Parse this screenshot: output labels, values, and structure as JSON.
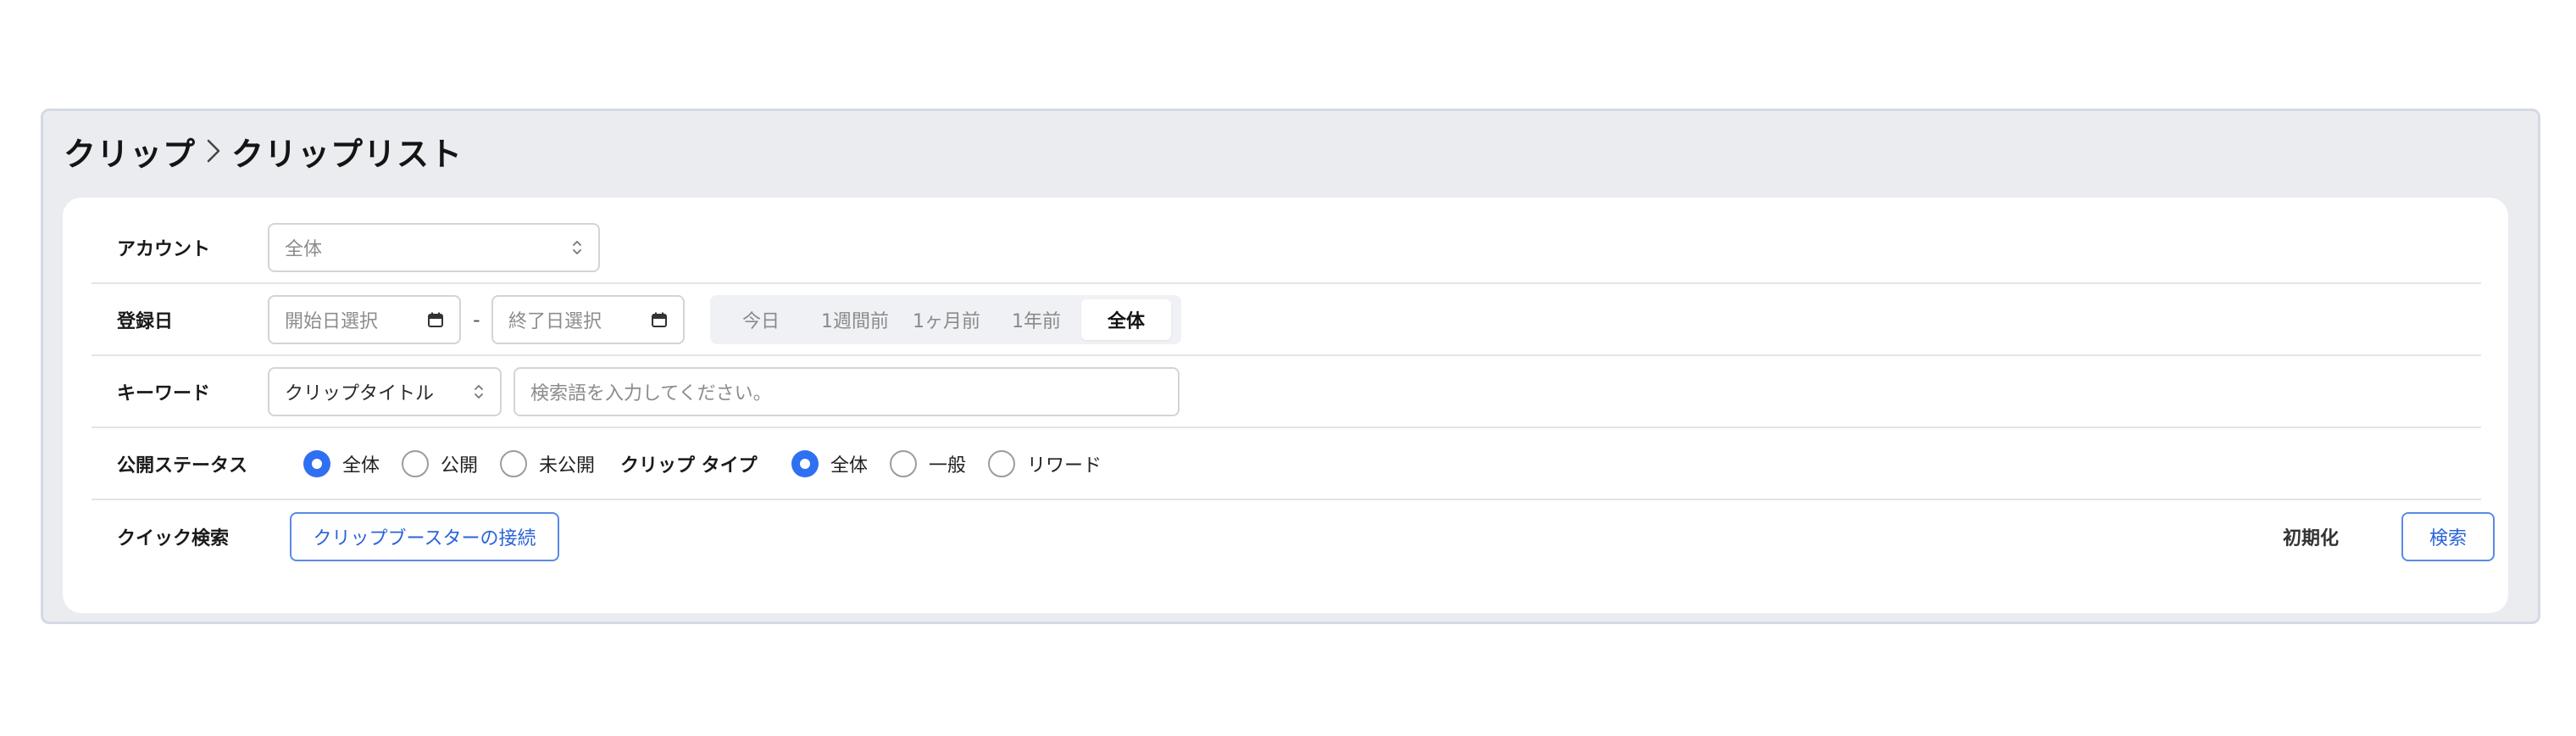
{
  "breadcrumb": {
    "parent": "クリップ",
    "current": "クリップリスト"
  },
  "filters": {
    "account": {
      "label": "アカウント",
      "value": "全体"
    },
    "registered_date": {
      "label": "登録日",
      "start_placeholder": "開始日選択",
      "separator": "-",
      "end_placeholder": "終了日選択",
      "ranges": [
        "今日",
        "1週間前",
        "1ヶ月前",
        "1年前",
        "全体"
      ],
      "selected_range": "全体"
    },
    "keyword": {
      "label": "キーワード",
      "field": "クリップタイトル",
      "placeholder": "検索語を入力してください。"
    },
    "publish_status": {
      "label": "公開ステータス",
      "options": [
        "全体",
        "公開",
        "未公開"
      ],
      "selected": "全体"
    },
    "clip_type": {
      "label": "クリップ タイプ",
      "options": [
        "全体",
        "一般",
        "リワード"
      ],
      "selected": "全体"
    },
    "quick_search": {
      "label": "クイック検索",
      "button": "クリップブースターの接続"
    }
  },
  "actions": {
    "reset": "初期化",
    "search": "検索"
  },
  "colors": {
    "accent": "#2f6ff2",
    "outer_bg": "#ebecf0",
    "card_bg": "#ffffff"
  }
}
